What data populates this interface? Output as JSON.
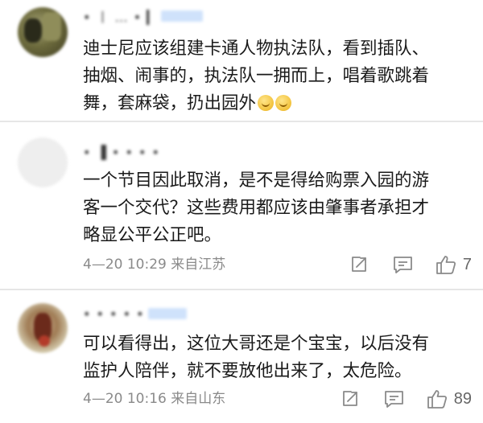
{
  "comments": [
    {
      "username": "• 丨 … • ▎",
      "text": "迪士尼应该组建卡通人物执法队，看到插队、\n抽烟、闹事的，执法队一拥而上，唱着歌跳着\n舞，套麻袋，扔出园外",
      "emojis": [
        "smile-emoji",
        "smile-emoji"
      ]
    },
    {
      "username": "• ▐ • • • •",
      "text": "一个节目因此取消，是不是得给购票入园的游\n客一个交代？这些费用都应该由肇事者承担才\n略显公平公正吧。",
      "meta": "4—20 10:29  来自江苏",
      "likes": "7"
    },
    {
      "username": "• • • • •",
      "text": "可以看得出，这位大哥还是个宝宝，以后没有\n监护人陪伴，就不要放他出来了，太危险。",
      "meta": "4—20 10:16  来自山东",
      "likes": "89"
    }
  ],
  "icons": {
    "share": "share-icon",
    "comment": "comment-icon",
    "like": "thumbs-up-icon"
  }
}
